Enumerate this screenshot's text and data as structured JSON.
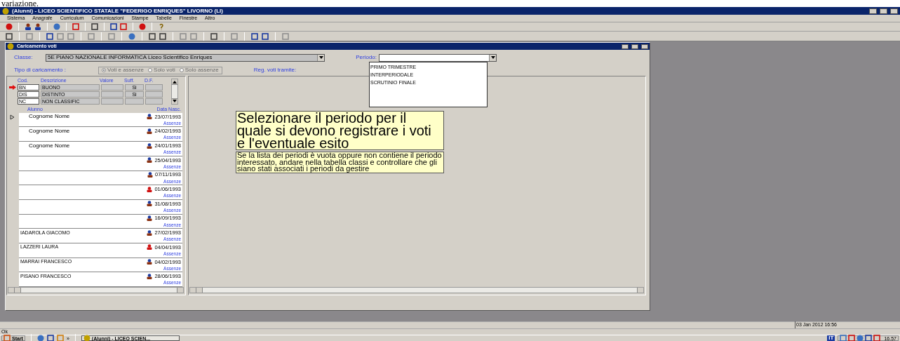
{
  "document_fragment": "variazione.",
  "window": {
    "title": "(Alunni) - LICEO SCIENTIFICO STATALE \"FEDERIGO ENRIQUES\" LIVORNO (LI)"
  },
  "menu": [
    "Sistema",
    "Anagrafe",
    "Curriculum",
    "Comunicazioni",
    "Stampe",
    "Tabelle",
    "Finestre",
    "Altro"
  ],
  "child_window": {
    "title": "Caricamento voti",
    "classe_label": "Classe:",
    "classe_value": "5E PIANO NAZIONALE INFORMATICA Liceo Scientifico Enriques",
    "periodo_label": "Periodo:",
    "periodo_options": [
      "PRIMO TRIMESTRE",
      "INTERPERIODALE",
      "SCRUTINIO FINALE"
    ],
    "tipo_label": "Tipo di caricamento :",
    "tipo_options": [
      {
        "label": "Voti e assenze",
        "selected": true
      },
      {
        "label": "Solo voti",
        "selected": false
      },
      {
        "label": "Solo assenze",
        "selected": false
      }
    ],
    "reg_label": "Reg. voti tramite:",
    "grades_columns": [
      "Cod.",
      "Descrizione",
      "Valore",
      "Suff.",
      "D.F."
    ],
    "grades": [
      {
        "cod": "BN",
        "descrizione": "BUONO",
        "suff": "Si",
        "selected": true
      },
      {
        "cod": "DIS",
        "descrizione": "DISTINTO",
        "suff": "Si",
        "selected": false
      },
      {
        "cod": "NC",
        "descrizione": "NON CLASSIFIC",
        "selected": false
      }
    ],
    "students_columns": [
      "Alunno",
      "Data Nasc."
    ],
    "students": [
      {
        "name": "Cognome Nome",
        "kind": "male",
        "date": "23/07/1993",
        "link": "Assenze",
        "selected": true
      },
      {
        "name": "Cognome Nome",
        "kind": "male",
        "date": "24/02/1993",
        "link": "Assenze",
        "selected": false
      },
      {
        "name": "Cognome Nome",
        "kind": "male",
        "date": "24/01/1993",
        "link": "Assenze",
        "selected": false
      },
      {
        "kind": "male",
        "date": "25/04/1993",
        "link": "Assenze",
        "selected": false
      },
      {
        "kind": "male",
        "date": "07/11/1993",
        "link": "Assenze",
        "selected": false
      },
      {
        "kind": "female",
        "date": "01/06/1993",
        "link": "Assenze",
        "selected": false
      },
      {
        "kind": "male",
        "date": "31/08/1993",
        "link": "Assenze",
        "selected": false
      },
      {
        "kind": "male",
        "date": "16/09/1993",
        "link": "Assenze",
        "selected": false
      },
      {
        "name": "IADAROLA GIACOMO",
        "kind": "male",
        "date": "27/02/1993",
        "link": "Assenze",
        "selected": false
      },
      {
        "name": "LAZZERI LAURA",
        "kind": "female",
        "date": "04/04/1993",
        "link": "Assenze",
        "selected": false
      },
      {
        "name": "MARRAI FRANCESCO",
        "kind": "male",
        "date": "04/02/1993",
        "link": "Assenze",
        "selected": false
      },
      {
        "name": "PISANO FRANCESCO",
        "kind": "male",
        "date": "28/06/1993",
        "link": "Assenze",
        "selected": false
      }
    ],
    "hint_title": "Selezionare il periodo per il quale si devono registrare i voti e l'eventuale esito",
    "hint_text": "Se la lista dei periodi è vuota oppure non contiene il periodo interessato, andare nella tabella classi e controllare che gli siano stati associati i periodi da gestire"
  },
  "status_bar": {
    "datetime": "03 Jan 2012 16:56",
    "message": "Ok"
  },
  "taskbar": {
    "start": "Start",
    "chevron": "»",
    "task": "(Alunni) - LICEO SCIEN...",
    "language": "IT",
    "clock": "16.57"
  }
}
